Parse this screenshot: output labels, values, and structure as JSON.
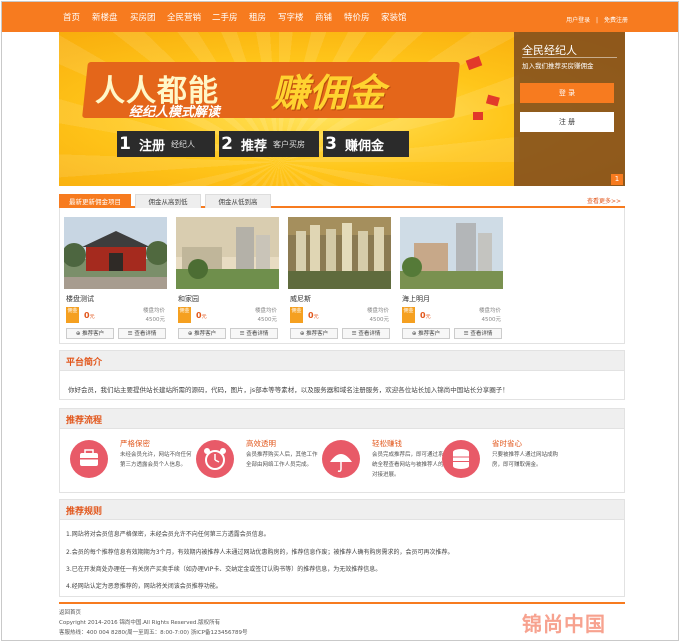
{
  "nav": {
    "items": [
      "首页",
      "新楼盘",
      "买房团",
      "全民营销",
      "二手房",
      "租房",
      "写字楼",
      "商铺",
      "特价房",
      "家装馆"
    ],
    "login": "用户登录",
    "register": "免费注册"
  },
  "banner": {
    "headline_a": "人人都能",
    "headline_b": "赚佣金",
    "subline": "经纪人模式解读",
    "steps": [
      {
        "num": "1",
        "big": "注册",
        "small": "经纪人"
      },
      {
        "num": "2",
        "big": "推荐",
        "small": "客户买房"
      },
      {
        "num": "3",
        "big": "赚佣金",
        "small": ""
      }
    ],
    "page_num": "1"
  },
  "agent_panel": {
    "title": "全民经纪人",
    "subtitle": "加入我们推荐买房赚佣金",
    "login_label": "登 录",
    "register_label": "注 册"
  },
  "tabs": {
    "items": [
      "最新更新佣金项目",
      "佣金从高到低",
      "佣金从低到高"
    ],
    "more": "查看更多>>"
  },
  "listings": [
    {
      "name": "楼盘测试",
      "badge": "佣金",
      "commission": "0",
      "unit": "元",
      "avg_label": "楼盘均价",
      "avg_value": "4500元",
      "btn_recommend": "推荐客户",
      "btn_detail": "查看详情"
    },
    {
      "name": "和家园",
      "badge": "佣金",
      "commission": "0",
      "unit": "元",
      "avg_label": "楼盘均价",
      "avg_value": "4500元",
      "btn_recommend": "推荐客户",
      "btn_detail": "查看详情"
    },
    {
      "name": "威尼斯",
      "badge": "佣金",
      "commission": "0",
      "unit": "元",
      "avg_label": "楼盘均价",
      "avg_value": "4500元",
      "btn_recommend": "推荐客户",
      "btn_detail": "查看详情"
    },
    {
      "name": "海上明月",
      "badge": "佣金",
      "commission": "0",
      "unit": "元",
      "avg_label": "楼盘均价",
      "avg_value": "4500元",
      "btn_recommend": "推荐客户",
      "btn_detail": "查看详情"
    }
  ],
  "platform": {
    "title": "平台简介",
    "text": "你好会员，我们站主要提供站长建站所需的源码，代码，图片，js部本等等素材，以及服务器和域名注册服务，欢迎各位站长加入锦尚中国站长分享圈子！"
  },
  "process": {
    "title": "推荐流程",
    "steps": [
      {
        "title": "严格保密",
        "desc": "未经会员允许，网站不向任何第三方透露会员个人信息。",
        "icon": "briefcase-icon"
      },
      {
        "title": "高效透明",
        "desc": "会员推荐购买人后，其他工作全部由网络工作人员完成。",
        "icon": "alarm-clock-icon"
      },
      {
        "title": "轻松赚钱",
        "desc": "会员完成推荐后，即可通过系统全程查看网站与被推荐人的对接进展。",
        "icon": "umbrella-icon"
      },
      {
        "title": "省时省心",
        "desc": "只要被推荐人通过网站成购房，即可赚取佣金。",
        "icon": "coins-icon"
      }
    ]
  },
  "rules": {
    "title": "推荐规则",
    "items": [
      "1.网站将对会员信息严格保密，未经会员允许不向任何第三方透露会员信息。",
      "2.会员的每个推荐信息有效期期为3个月，有效期内被推荐人未通过网站优惠购房的，推荐信息作废；被推荐人确有购房需求的，会员可再次推荐。",
      "3.已在开发商处办理任一有关房产买卖手续（如办理VIP卡、交纳定金或签订认购书等）的推荐信息，为无效推荐信息。",
      "4.经网站认定为恶意推荐的，网站将关闭该会员推荐功能。"
    ]
  },
  "footer": {
    "link": "返回首页",
    "copyright": "Copyright 2014-2016 锦尚中国.All Rights Reserved.版权所有",
    "contact": "客服热线：400 004 8280(周一至周五：8:00-7:00)  浙ICP备123456789号",
    "logo": "锦尚中国"
  },
  "colors": {
    "accent": "#f77b1f",
    "title_red": "#e2571c",
    "icon_red": "#e85a68"
  }
}
